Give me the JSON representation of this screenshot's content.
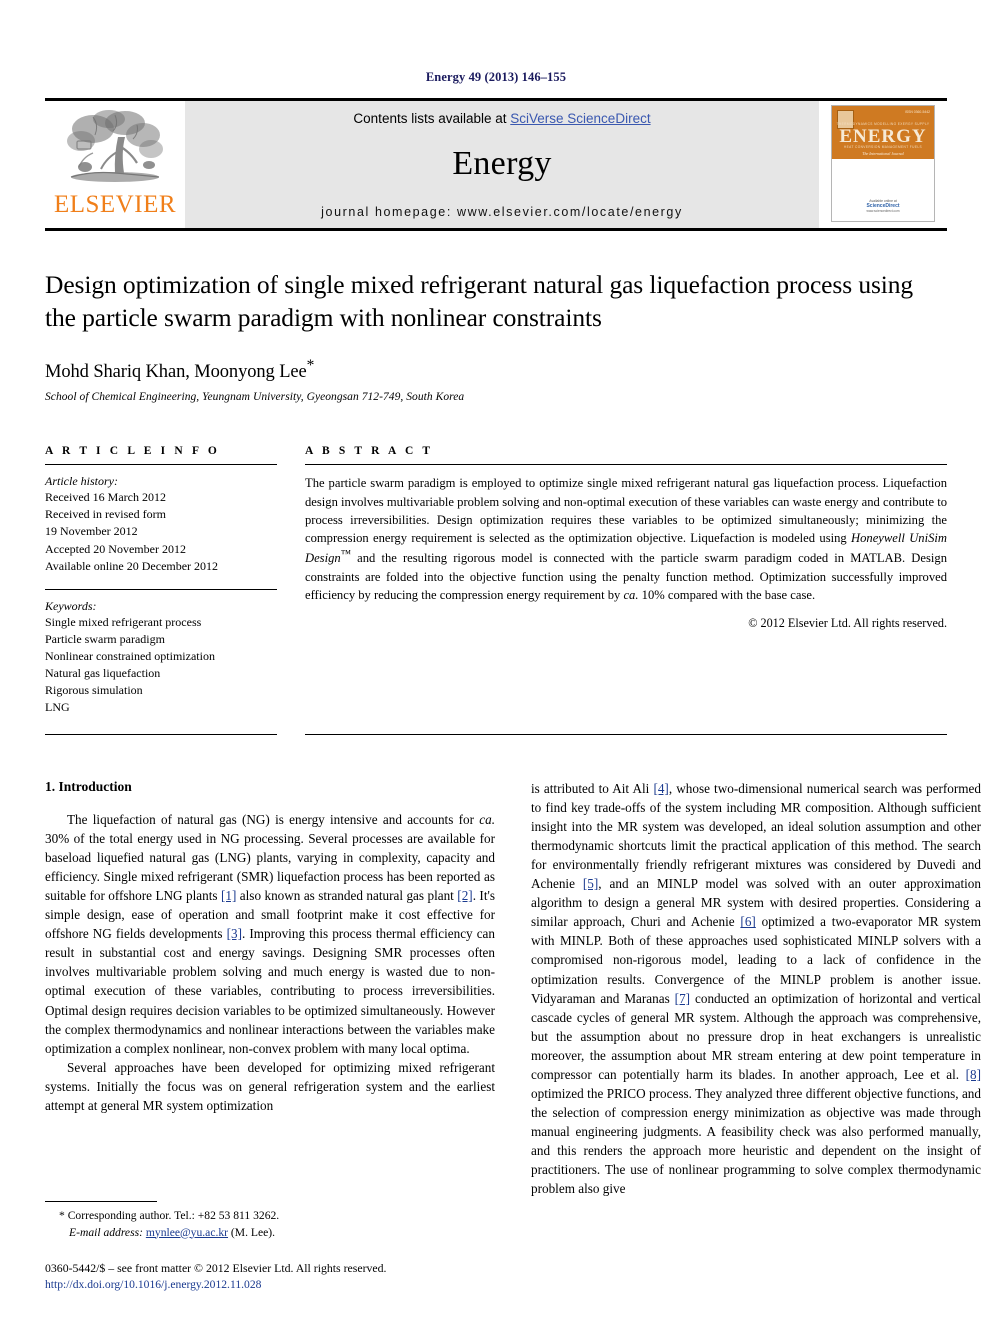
{
  "running_head": "Energy 49 (2013) 146–155",
  "masthead": {
    "publisher_logo_text": "ELSEVIER",
    "contents_prefix": "Contents lists available at ",
    "contents_link": "SciVerse ScienceDirect",
    "journal_name": "Energy",
    "homepage": "journal homepage: www.elsevier.com/locate/energy",
    "cover": {
      "title": "ENERGY",
      "issn": "ISSN 0360-5442",
      "row_top": "THERMODYNAMICS   MODELLING   EXERGY   SUPPLY",
      "row_bottom": "HEAT   CONVERSION   MANAGEMENT   FUELS",
      "tagline": "The International Journal",
      "available_label": "Available online at",
      "sd_logo": "ScienceDirect",
      "sd_url": "www.sciencedirect.com"
    }
  },
  "article": {
    "title_line1": "Design optimization of single mixed refrigerant natural gas liquefaction process",
    "title_line2": "using the particle swarm paradigm with nonlinear constraints",
    "authors": "Mohd Shariq Khan, Moonyong Lee",
    "author_marker": "*",
    "affiliation": "School of Chemical Engineering, Yeungnam University, Gyeongsan 712-749, South Korea"
  },
  "article_info": {
    "heading": "A R T I C L E  I N F O",
    "history_label": "Article history:",
    "history": [
      "Received 16 March 2012",
      "Received in revised form",
      "19 November 2012",
      "Accepted 20 November 2012",
      "Available online 20 December 2012"
    ],
    "keywords_label": "Keywords:",
    "keywords": [
      "Single mixed refrigerant process",
      "Particle swarm paradigm",
      "Nonlinear constrained optimization",
      "Natural gas liquefaction",
      "Rigorous simulation",
      "LNG"
    ]
  },
  "abstract": {
    "heading": "A B S T R A C T",
    "part1": "The particle swarm paradigm is employed to optimize single mixed refrigerant natural gas liquefaction process. Liquefaction design involves multivariable problem solving and non-optimal execution of these variables can waste energy and contribute to process irreversibilities. Design optimization requires these variables to be optimized simultaneously; minimizing the compression energy requirement is selected as the optimization objective. Liquefaction is modeled using ",
    "italic1": "Honeywell UniSim Design",
    "tm": "™",
    "part2": " and the resulting rigorous model is connected with the particle swarm paradigm coded in MATLAB. Design constraints are folded into the objective function using the penalty function method. Optimization successfully improved efficiency by reducing the compression energy requirement by ",
    "italic2": "ca.",
    "part3": " 10% compared with the base case.",
    "copyright": "© 2012 Elsevier Ltd. All rights reserved."
  },
  "body": {
    "section_number_title": "1. Introduction",
    "left_paragraphs": [
      {
        "segments": [
          {
            "t": "The liquefaction of natural gas (NG) is energy intensive and accounts for "
          },
          {
            "t": "ca.",
            "italic": true
          },
          {
            "t": " 30% of the total energy used in NG processing. Several processes are available for baseload liquefied natural gas (LNG) plants, varying in complexity, capacity and efficiency. Single mixed refrigerant (SMR) liquefaction process has been reported as suitable for offshore LNG plants "
          },
          {
            "t": "[1]",
            "ref": true
          },
          {
            "t": " also known as stranded natural gas plant "
          },
          {
            "t": "[2]",
            "ref": true
          },
          {
            "t": ". It's simple design, ease of operation and small footprint make it cost effective for offshore NG fields developments "
          },
          {
            "t": "[3]",
            "ref": true
          },
          {
            "t": ". Improving this process thermal efficiency can result in substantial cost and energy savings. Designing SMR processes often involves multivariable problem solving and much energy is wasted due to non-optimal execution of these variables, contributing to process irreversibilities. Optimal design requires decision variables to be optimized simultaneously. However the complex thermodynamics and nonlinear interactions between the variables make optimization a complex nonlinear, non-convex problem with many local optima."
          }
        ]
      },
      {
        "segments": [
          {
            "t": "Several approaches have been developed for optimizing mixed refrigerant systems. Initially the focus was on general refrigeration system and the earliest attempt at general MR system optimization"
          }
        ]
      }
    ],
    "right_paragraphs": [
      {
        "continued": true,
        "segments": [
          {
            "t": "is attributed to Ait Ali "
          },
          {
            "t": "[4]",
            "ref": true
          },
          {
            "t": ", whose two-dimensional numerical search was performed to find key trade-offs of the system including MR composition. Although sufficient insight into the MR system was developed, an ideal solution assumption and other thermodynamic shortcuts limit the practical application of this method. The search for environmentally friendly refrigerant mixtures was considered by Duvedi and Achenie "
          },
          {
            "t": "[5]",
            "ref": true
          },
          {
            "t": ", and an MINLP model was solved with an outer approximation algorithm to design a general MR system with desired properties. Considering a similar approach, Churi and Achenie "
          },
          {
            "t": "[6]",
            "ref": true
          },
          {
            "t": " optimized a two-evaporator MR system with MINLP. Both of these approaches used sophisticated MINLP solvers with a compromised non-rigorous model, leading to a lack of confidence in the optimization results. Convergence of the MINLP problem is another issue. Vidyaraman and Maranas "
          },
          {
            "t": "[7]",
            "ref": true
          },
          {
            "t": " conducted an optimization of horizontal and vertical cascade cycles of general MR system. Although the approach was comprehensive, but the assumption about no pressure drop in heat exchangers is unrealistic moreover, the assumption about MR stream entering at dew point temperature in compressor can potentially harm its blades. In another approach, Lee et al. "
          },
          {
            "t": "[8]",
            "ref": true
          },
          {
            "t": " optimized the PRICO process. They analyzed three different objective functions, and the selection of compression energy minimization as objective was made through manual engineering judgments. A feasibility check was also performed manually, and this renders the approach more heuristic and dependent on the insight of practitioners. The use of nonlinear programming to solve complex thermodynamic problem also give"
          }
        ]
      }
    ]
  },
  "footnotes": {
    "corresponding_marker": "*",
    "corresponding": " Corresponding author. Tel.: +82 53 811 3262.",
    "email_label": "E-mail address:",
    "email": "mynlee@yu.ac.kr",
    "email_suffix": " (M. Lee).",
    "issn_line": "0360-5442/$ – see front matter © 2012 Elsevier Ltd. All rights reserved.",
    "doi": "http://dx.doi.org/10.1016/j.energy.2012.11.028"
  },
  "colors": {
    "link_blue": "#1a3a8f",
    "sciencedirect_blue": "#3a58b0",
    "elsevier_orange": "#f07f1a",
    "cover_orange": "#cf7a22",
    "banner_gray": "#e6e6e6"
  }
}
